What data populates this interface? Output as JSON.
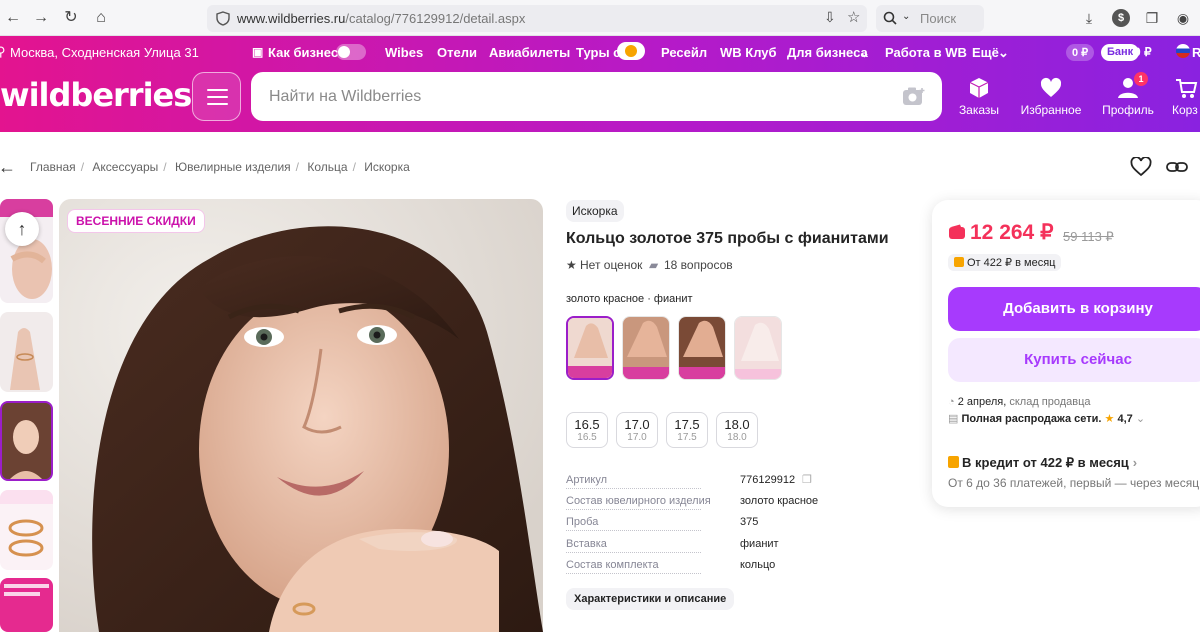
{
  "browser": {
    "url_host": "www.wildberries.ru",
    "url_path": "/catalog/776129912/detail.aspx",
    "search_placeholder": "Поиск"
  },
  "topbar": {
    "location": "Москва, Сходненская Улица 31",
    "business_toggle": "Как бизнес",
    "links": [
      "Wibes",
      "Отели",
      "Авиабилеты",
      "Туры с",
      "Ресейл",
      "WB Клуб",
      "Для бизнеса",
      "Работа в WB",
      "Ещё"
    ],
    "wallet": "0 ₽",
    "bank": "Банк",
    "bank_balance": "0 ₽",
    "lang": "R"
  },
  "header": {
    "logo": "wildberries",
    "search_placeholder": "Найти на Wildberries",
    "nav": [
      {
        "label": "Заказы",
        "icon": "box-icon"
      },
      {
        "label": "Избранное",
        "icon": "heart-icon"
      },
      {
        "label": "Профиль",
        "icon": "user-icon",
        "badge": "1"
      },
      {
        "label": "Корз",
        "icon": "cart-icon"
      }
    ]
  },
  "breadcrumbs": [
    "Главная",
    "Аксессуары",
    "Ювелирные изделия",
    "Кольца",
    "Искорка"
  ],
  "gallery": {
    "sale_tag": "ВЕСЕННИЕ СКИДКИ"
  },
  "product": {
    "brand": "Искорка",
    "title": "Кольцо золотое 375 пробы с фианитами",
    "rating": "Нет оценок",
    "questions": "18 вопросов",
    "color_label": "золото красное · фианит",
    "sizes": [
      {
        "ru": "16.5",
        "sub": "16.5"
      },
      {
        "ru": "17.0",
        "sub": "17.0"
      },
      {
        "ru": "17.5",
        "sub": "17.5"
      },
      {
        "ru": "18.0",
        "sub": "18.0"
      }
    ],
    "specs": [
      {
        "k": "Артикул",
        "v": "776129912"
      },
      {
        "k": "Состав ювелирного изделия",
        "v": "золото красное"
      },
      {
        "k": "Проба",
        "v": "375"
      },
      {
        "k": "Вставка",
        "v": "фианит"
      },
      {
        "k": "Состав комплекта",
        "v": "кольцо"
      }
    ],
    "details_button": "Характеристики и описание"
  },
  "buy": {
    "price": "12 264 ₽",
    "old_price": "59 113 ₽",
    "installment": "От 422 ₽ в месяц",
    "add_to_cart": "Добавить в корзину",
    "buy_now": "Купить сейчас",
    "delivery_date": "2 апреля,",
    "delivery_src": "склад продавца",
    "seller": "Полная распродажа сети.",
    "seller_rating": "4,7",
    "credit": "В кредит от 422 ₽ в месяц",
    "credit_sub": "От 6 до 36 платежей, первый — через месяц"
  },
  "colors": {
    "accent": "#a73afd",
    "price": "#f4315a",
    "brand": "#cb11ab"
  }
}
